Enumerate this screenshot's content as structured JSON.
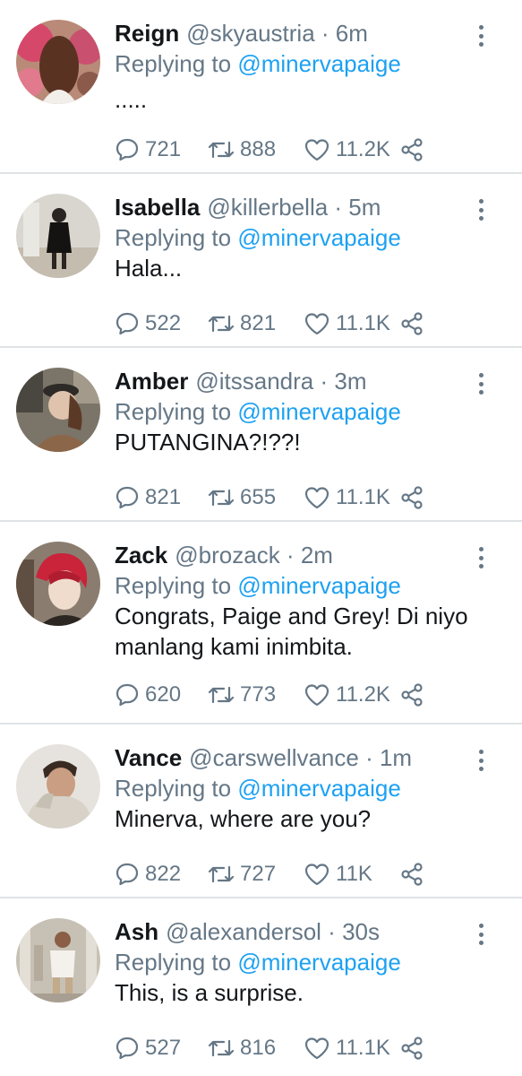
{
  "tweets": [
    {
      "name": "Reign",
      "handle": "@skyaustria",
      "time": "6m",
      "replying_prefix": "Replying to",
      "replying_to": "@minervapaige",
      "text": ".....",
      "replies": "721",
      "retweets": "888",
      "likes": "11.2K",
      "avatar": "avatar-reign"
    },
    {
      "name": "Isabella",
      "handle": "@killerbella",
      "time": "5m",
      "replying_prefix": "Replying to",
      "replying_to": "@minervapaige",
      "text": "Hala...",
      "replies": "522",
      "retweets": "821",
      "likes": "11.1K",
      "avatar": "avatar-isabella"
    },
    {
      "name": "Amber",
      "handle": "@itssandra",
      "time": "3m",
      "replying_prefix": "Replying to",
      "replying_to": "@minervapaige",
      "text": "PUTANGINA?!??!",
      "replies": "821",
      "retweets": "655",
      "likes": "11.1K",
      "avatar": "avatar-amber"
    },
    {
      "name": "Zack",
      "handle": "@brozack",
      "time": "2m",
      "replying_prefix": "Replying to",
      "replying_to": "@minervapaige",
      "text": "Congrats, Paige and Grey! Di niyo manlang kami inimbita.",
      "replies": "620",
      "retweets": "773",
      "likes": "11.2K",
      "avatar": "avatar-zack"
    },
    {
      "name": "Vance",
      "handle": "@carswellvance",
      "time": "1m",
      "replying_prefix": "Replying to",
      "replying_to": "@minervapaige",
      "text": "Minerva, where are you?",
      "replies": "822",
      "retweets": "727",
      "likes": "11K",
      "avatar": "avatar-vance"
    },
    {
      "name": "Ash",
      "handle": "@alexandersol",
      "time": "30s",
      "replying_prefix": "Replying to",
      "replying_to": "@minervapaige",
      "text": "This, is a surprise.",
      "replies": "527",
      "retweets": "816",
      "likes": "11.1K",
      "avatar": "avatar-ash"
    }
  ],
  "colors": {
    "accent": "#1da1f2",
    "muted": "#657786",
    "text": "#14171a",
    "divider": "#dfe3e6"
  },
  "icons": {
    "menu": "more-vertical-icon",
    "reply": "reply-bubble-icon",
    "retweet": "retweet-icon",
    "like": "heart-icon",
    "share": "share-icon"
  }
}
